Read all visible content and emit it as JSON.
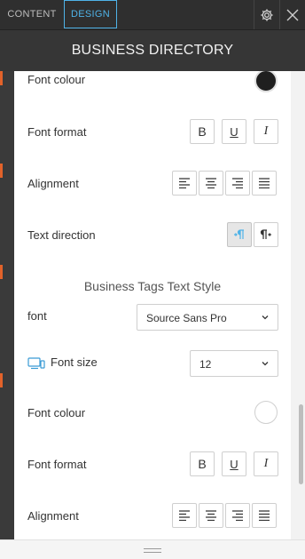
{
  "tabs": {
    "content": "CONTENT",
    "design": "DESIGN"
  },
  "title": "BUSINESS DIRECTORY",
  "colors": {
    "accent": "#4fb3e8",
    "swatch_dark": "#1f1f1f",
    "swatch_light": "#ffffff",
    "orange": "#e2622a"
  },
  "rows": {
    "font_colour_1": "Font colour",
    "font_format_1": "Font format",
    "alignment_1": "Alignment",
    "text_direction": "Text direction",
    "section_title": "Business Tags Text Style",
    "font": "font",
    "font_size": "Font size",
    "font_colour_2": "Font colour",
    "font_format_2": "Font format",
    "alignment_2": "Alignment"
  },
  "font_select": {
    "value": "Source Sans Pro"
  },
  "font_size_select": {
    "value": "12"
  },
  "format_buttons": {
    "bold": "B",
    "underline": "U",
    "italic": "I"
  },
  "icons": [
    "gear-icon",
    "close-icon",
    "align-left-icon",
    "align-center-icon",
    "align-right-icon",
    "align-justify-icon",
    "ltr-icon",
    "rtl-icon",
    "chevron-down-icon",
    "devices-icon",
    "resize-grip-icon"
  ]
}
